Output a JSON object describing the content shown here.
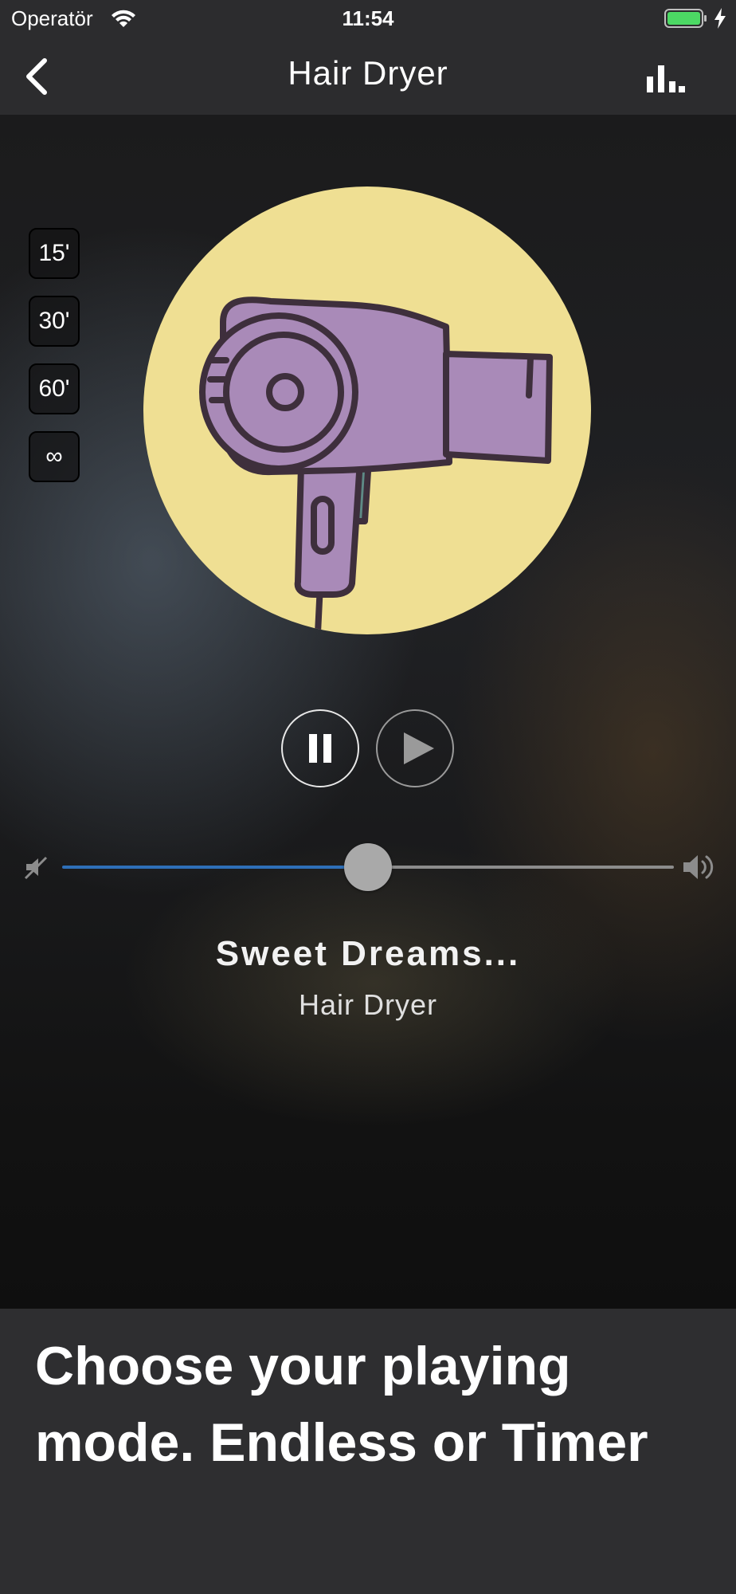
{
  "status_bar": {
    "carrier": "Operatör",
    "time": "11:54",
    "battery_color": "#4cd964"
  },
  "nav": {
    "title": "Hair Dryer",
    "back_icon": "chevron-left-icon",
    "stats_icon": "bar-chart-icon"
  },
  "timer_modes": [
    {
      "label": "15'"
    },
    {
      "label": "30'"
    },
    {
      "label": "60'"
    },
    {
      "label": "∞"
    }
  ],
  "artwork": {
    "icon": "hair-dryer-icon",
    "circle_color": "#efdf93",
    "dryer_color": "#a98ab8",
    "outline_color": "#3e2f3c"
  },
  "controls": {
    "pause_icon": "pause-icon",
    "play_icon": "play-icon"
  },
  "volume": {
    "level": 0.5,
    "fill_color": "#2e6fb8",
    "mute_icon": "mute-icon",
    "volume_icon": "volume-icon"
  },
  "track": {
    "title": "Sweet Dreams...",
    "subtitle": "Hair Dryer"
  },
  "caption": {
    "text": "Choose your playing mode. Endless or Timer"
  }
}
